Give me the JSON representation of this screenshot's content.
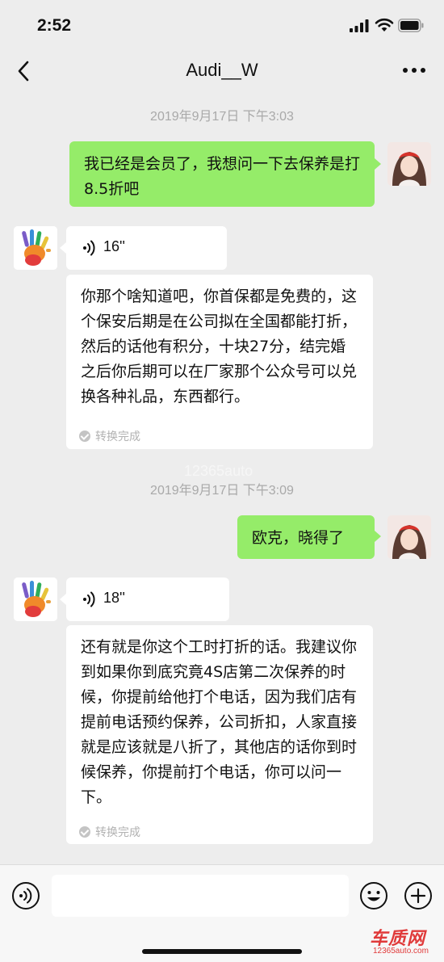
{
  "status": {
    "time": "2:52"
  },
  "nav": {
    "title": "Audi__W"
  },
  "messages": {
    "ts1": "2019年9月17日 下午3:03",
    "me1": "我已经是会员了，我想问一下去保养是打8.5折吧",
    "voice1": {
      "duration": "16''"
    },
    "transcript1": "你那个啥知道吧，你首保都是免费的，这个保安后期是在公司拟在全国都能打折，然后的话他有积分，十块27分，结完婚之后你后期可以在厂家那个公众号可以兑换各种礼品，东西都行。",
    "converted1": "转换完成",
    "ts2": "2019年9月17日 下午3:09",
    "me2": "欧克，晓得了",
    "voice2": {
      "duration": "18''"
    },
    "transcript2": "还有就是你这个工时打折的话。我建议你到如果你到底究竟4S店第二次保养的时候，你提前给他打个电话，因为我们店有提前电话预约保养，公司折扣，人家直接就是应该就是八折了，其他店的话你到时候保养，你提前打个电话，你可以问一下。",
    "converted2": "转换完成"
  },
  "watermark": {
    "logo": "车质网",
    "url": "12365auto.com",
    "mid": "12365auto"
  },
  "colors": {
    "my_bubble": "#95ec69",
    "background": "#ededed"
  }
}
